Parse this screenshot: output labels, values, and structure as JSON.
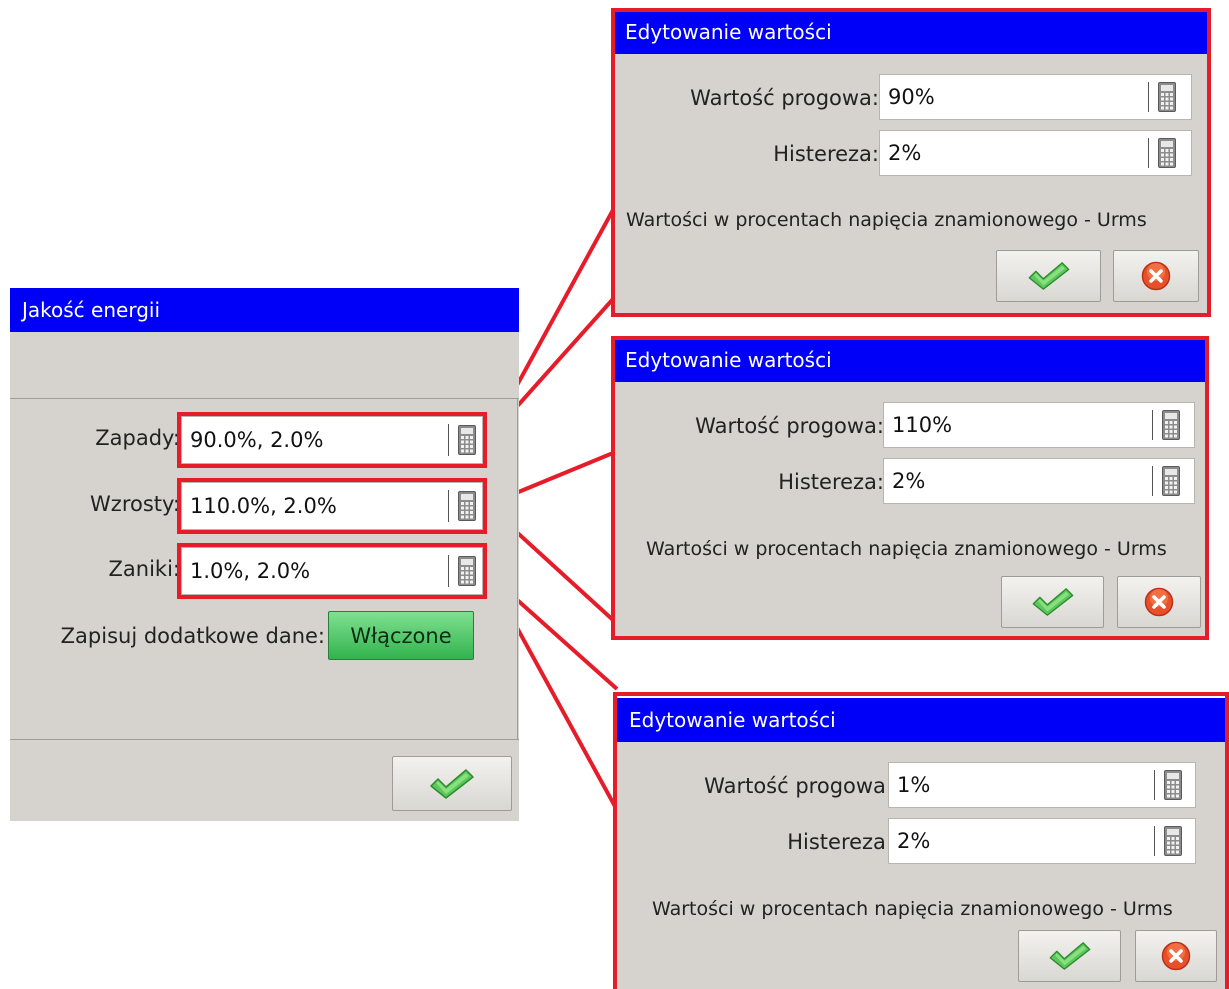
{
  "main": {
    "title": "Jakość energii",
    "rows": [
      {
        "label": "Zapady:",
        "value": "90.0%, 2.0%"
      },
      {
        "label": "Wzrosty:",
        "value": "110.0%, 2.0%"
      },
      {
        "label": "Zaniki:",
        "value": "1.0%, 2.0%"
      }
    ],
    "extra_label": "Zapisuj dodatkowe dane:",
    "extra_toggle": "Włączone",
    "ok_icon": "check-icon"
  },
  "dialogs": [
    {
      "title": "Edytowanie wartości",
      "threshold_label": "Wartość progowa:",
      "threshold_value": "90%",
      "hysteresis_label": "Histereza:",
      "hysteresis_value": "2%",
      "hint": "Wartości w procentach napięcia znamionowego - Urms"
    },
    {
      "title": "Edytowanie wartości",
      "threshold_label": "Wartość progowa:",
      "threshold_value": "110%",
      "hysteresis_label": "Histereza:",
      "hysteresis_value": "2%",
      "hint": "Wartości w procentach napięcia znamionowego - Urms"
    },
    {
      "title": "Edytowanie wartości",
      "threshold_label": "Wartość progowa:",
      "threshold_value": "1%",
      "hysteresis_label": "Histereza:",
      "hysteresis_value": "2%",
      "hint": "Wartości w procentach napięcia znamionowego - Urms"
    }
  ],
  "colors": {
    "titlebar": "#0000f8",
    "highlight": "#e51d2a",
    "panel": "#d6d3ce",
    "toggle_on": "#3fbf5a"
  }
}
